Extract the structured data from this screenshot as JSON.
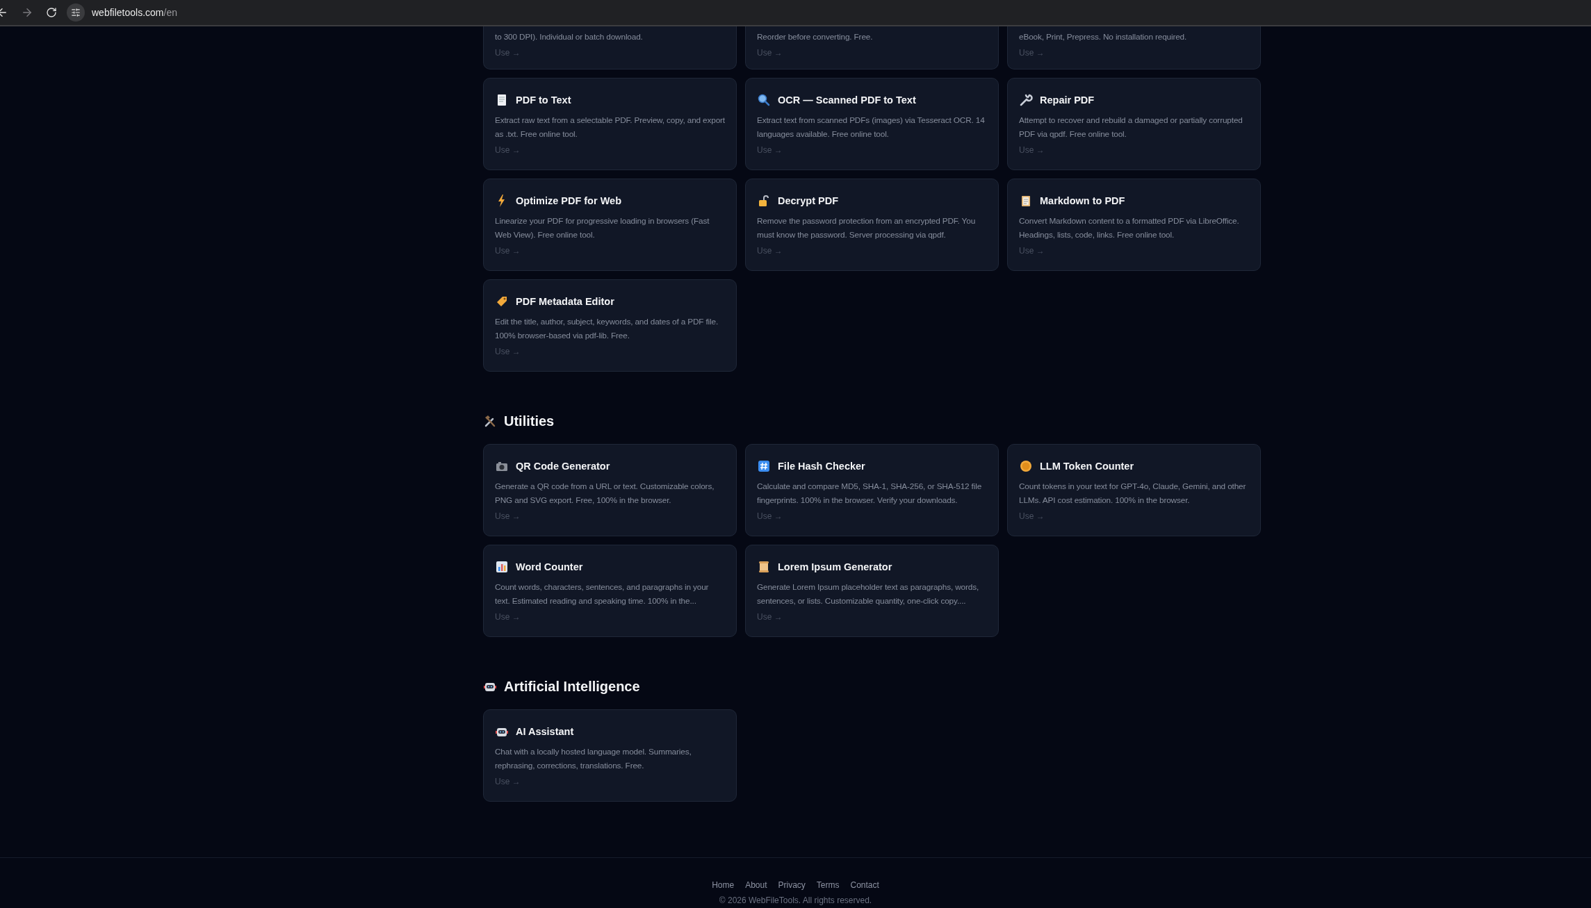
{
  "browser": {
    "url_host": "webfiletools.com",
    "url_path": "/en"
  },
  "sections": [
    {
      "cards": [
        {
          "kind": "cut",
          "description": "to 300 DPI). Individual or batch download.",
          "action": "Use →"
        },
        {
          "kind": "cut",
          "description": "Reorder before converting. Free.",
          "action": "Use →"
        },
        {
          "kind": "cut",
          "description": "eBook, Print, Prepress. No installation required.",
          "action": "Use →"
        },
        {
          "kind": "full",
          "title": "PDF to Text",
          "description": "Extract raw text from a selectable PDF. Preview, copy, and export as .txt. Free online tool.",
          "action": "Use →"
        },
        {
          "kind": "full",
          "title": "OCR — Scanned PDF to Text",
          "description": "Extract text from scanned PDFs (images) via Tesseract OCR. 14 languages available. Free online tool.",
          "action": "Use →"
        },
        {
          "kind": "full",
          "title": "Repair PDF",
          "description": "Attempt to recover and rebuild a damaged or partially corrupted PDF via qpdf. Free online tool.",
          "action": "Use →"
        },
        {
          "kind": "full",
          "title": "Optimize PDF for Web",
          "description": "Linearize your PDF for progressive loading in browsers (Fast Web View). Free online tool.",
          "action": "Use →"
        },
        {
          "kind": "full",
          "title": "Decrypt PDF",
          "description": "Remove the password protection from an encrypted PDF. You must know the password. Server processing via qpdf.",
          "action": "Use →"
        },
        {
          "kind": "full",
          "title": "Markdown to PDF",
          "description": "Convert Markdown content to a formatted PDF via LibreOffice. Headings, lists, code, links. Free online tool.",
          "action": "Use →"
        },
        {
          "kind": "full",
          "title": "PDF Metadata Editor",
          "description": "Edit the title, author, subject, keywords, and dates of a PDF file. 100% browser-based via pdf-lib. Free.",
          "action": "Use →"
        }
      ]
    },
    {
      "title": "Utilities",
      "cards": [
        {
          "kind": "full",
          "title": "QR Code Generator",
          "description": "Generate a QR code from a URL or text. Customizable colors, PNG and SVG export. Free, 100% in the browser.",
          "action": "Use →"
        },
        {
          "kind": "full",
          "title": "File Hash Checker",
          "description": "Calculate and compare MD5, SHA-1, SHA-256, or SHA-512 file fingerprints. 100% in the browser. Verify your downloads.",
          "action": "Use →"
        },
        {
          "kind": "full",
          "title": "LLM Token Counter",
          "description": "Count tokens in your text for GPT-4o, Claude, Gemini, and other LLMs. API cost estimation. 100% in the browser.",
          "action": "Use →"
        },
        {
          "kind": "full",
          "title": "Word Counter",
          "description": "Count words, characters, sentences, and paragraphs in your text. Estimated reading and speaking time. 100% in the...",
          "action": "Use →"
        },
        {
          "kind": "full",
          "title": "Lorem Ipsum Generator",
          "description": "Generate Lorem Ipsum placeholder text as paragraphs, words, sentences, or lists. Customizable quantity, one-click copy....",
          "action": "Use →"
        }
      ]
    },
    {
      "title": "Artificial Intelligence",
      "cards": [
        {
          "kind": "full",
          "title": "AI Assistant",
          "description": "Chat with a locally hosted language model. Summaries, rephrasing, corrections, translations. Free.",
          "action": "Use →"
        }
      ]
    }
  ],
  "footer": {
    "links": [
      "Home",
      "About",
      "Privacy",
      "Terms",
      "Contact"
    ],
    "copyright": "© 2026 WebFileTools. All rights reserved."
  }
}
